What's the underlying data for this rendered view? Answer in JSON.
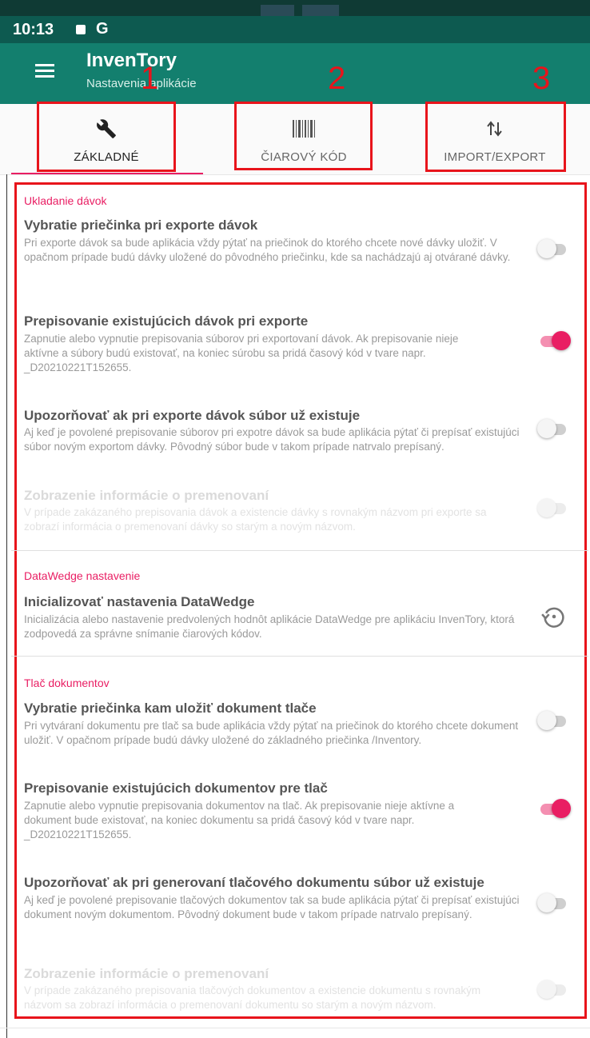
{
  "status_bar": {
    "time": "10:13",
    "icon_g": "G"
  },
  "app_bar": {
    "title": "InvenTory",
    "subtitle": "Nastavenia aplikácie"
  },
  "tabs": [
    {
      "label": "ZÁKLADNÉ",
      "icon": "wrench-icon",
      "selected": true
    },
    {
      "label": "ČIAROVÝ KÓD",
      "icon": "barcode-icon",
      "selected": false
    },
    {
      "label": "IMPORT/EXPORT",
      "icon": "import-export-icon",
      "selected": false
    }
  ],
  "annotations": {
    "n1": "1",
    "n2": "2",
    "n3": "3"
  },
  "sections": {
    "batch": {
      "title": "Ukladanie dávok",
      "items": [
        {
          "title": "Vybratie priečinka pri exporte dávok",
          "desc": "Pri exporte dávok sa bude aplikácia vždy pýtať na priečinok do ktorého chcete nové dávky uložiť. V opačnom prípade budú dávky uložené do pôvodného priečinku, kde sa nachádzajú aj otvárané dávky.",
          "switch": "off"
        },
        {
          "title": "Prepisovanie existujúcich dávok pri exporte",
          "desc": "Zapnutie alebo vypnutie prepisovania súborov pri exportovaní dávok. Ak prepisovanie nieje aktívne a súbory budú existovať, na koniec súrobu sa pridá časový kód v tvare napr. _D20210221T152655.",
          "switch": "on"
        },
        {
          "title": "Upozorňovať ak pri exporte dávok súbor už existuje",
          "desc": "Aj keď je povolené prepisovanie súborov pri expotre dávok sa bude aplikácia pýtať či prepísať existujúci súbor novým exportom dávky. Pôvodný súbor bude v takom prípade natrvalo prepísaný.",
          "switch": "off"
        },
        {
          "title": "Zobrazenie informácie o premenovaní",
          "desc": "V prípade zakázaného prepisovania dávok a existencie dávky s rovnakým názvom pri exporte sa zobrazí informácia o premenovaní dávky so starým a novým názvom.",
          "switch": "disabled"
        }
      ]
    },
    "datawedge": {
      "title": "DataWedge nastavenie",
      "items": [
        {
          "title": "Inicializovať nastavenia DataWedge",
          "desc": "Inicializácia alebo nastavenie predvolených hodnôt aplikácie DataWedge pre aplikáciu InvenTory, ktorá zodpovedá za správne snímanie čiarových kódov."
        }
      ]
    },
    "print": {
      "title": "Tlač dokumentov",
      "items": [
        {
          "title": "Vybratie priečinka kam uložiť dokument tlače",
          "desc": "Pri vytváraní dokumentu pre tlač sa bude aplikácia vždy pýtať na priečinok do ktorého chcete dokument uložiť. V opačnom prípade budú dávky uložené do základného priečinka /Inventory.",
          "switch": "off"
        },
        {
          "title": "Prepisovanie existujúcich dokumentov pre tlač",
          "desc": "Zapnutie alebo vypnutie prepisovania dokumentov na tlač. Ak prepisovanie nieje aktívne a dokument bude existovať, na koniec dokumentu sa pridá časový kód v tvare napr. _D20210221T152655.",
          "switch": "on"
        },
        {
          "title": "Upozorňovať ak pri generovaní tlačového dokumentu súbor už existuje",
          "desc": "Aj keď je povolené prepisovanie tlačových dokumentov tak sa bude aplikácia pýtať či prepísať existujúci dokument novým dokumentom. Pôvodný dokument bude v takom prípade natrvalo prepísaný.",
          "switch": "off"
        },
        {
          "title": "Zobrazenie informácie o premenovaní",
          "desc": "V prípade zakázaného prepisovania tlačových dokumentov a existencie dokumentu s rovnakým názvom sa zobrazí informácia o premenovaní dokumentu so starým a novým názvom.",
          "switch": "disabled"
        }
      ]
    }
  },
  "colors": {
    "primary_dark": "#0d5a50",
    "primary": "#137f6e",
    "accent": "#e91e63",
    "annotation_red": "#e8141b"
  }
}
